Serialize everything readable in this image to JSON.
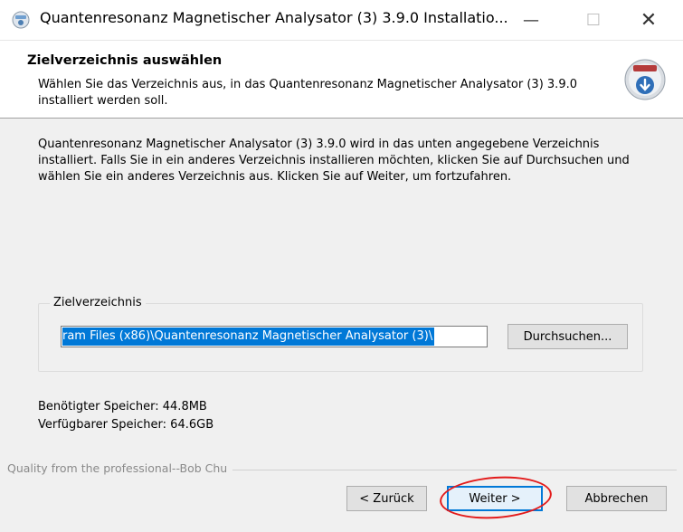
{
  "window": {
    "title": "Quantenresonanz Magnetischer Analysator (3) 3.9.0 Installatio...",
    "min_glyph": "—",
    "max_glyph": "☐",
    "close_glyph": "✕",
    "icon": "installer-app-icon"
  },
  "header": {
    "title": "Zielverzeichnis auswählen",
    "subtitle": "Wählen Sie das Verzeichnis aus, in das Quantenresonanz Magnetischer Analysator (3) 3.9.0 installiert werden soll.",
    "icon": "install-disc-icon"
  },
  "content": {
    "intro": "Quantenresonanz Magnetischer Analysator (3) 3.9.0 wird in das unten angegebene Verzeichnis installiert. Falls Sie in ein anderes Verzeichnis installieren möchten, klicken Sie auf Durchsuchen und wählen Sie ein anderes Verzeichnis aus. Klicken Sie auf Weiter, um fortzufahren.",
    "group_label": "Zielverzeichnis",
    "path_value": "ram Files (x86)\\Quantenresonanz Magnetischer Analysator (3)\\",
    "browse_label": "Durchsuchen...",
    "space_required": "Benötigter Speicher: 44.8MB",
    "space_available": "Verfügbarer Speicher: 64.6GB"
  },
  "footer": {
    "branding": "Quality from the professional--Bob Chu",
    "back_label": "< Zurück",
    "next_label": "Weiter >",
    "cancel_label": "Abbrechen"
  },
  "colors": {
    "accent": "#0078d7",
    "annotation": "#e31b1b"
  }
}
